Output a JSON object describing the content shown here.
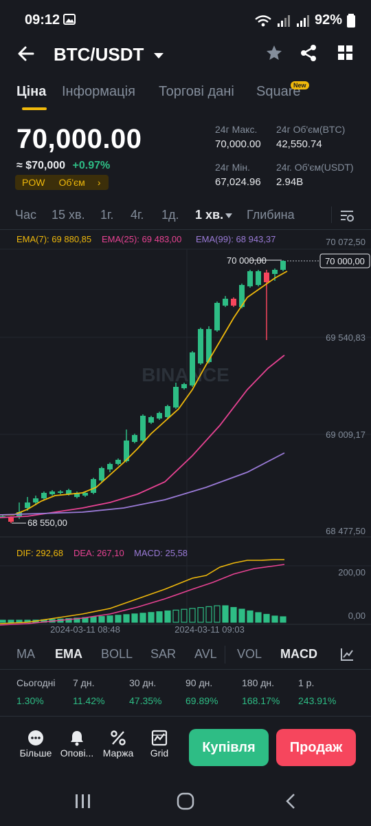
{
  "status_bar": {
    "time": "09:12",
    "battery": "92%"
  },
  "header": {
    "pair": "BTC/USDT"
  },
  "tabs": [
    {
      "label": "Ціна"
    },
    {
      "label": "Інформація"
    },
    {
      "label": "Торгові дані"
    },
    {
      "label": "Square",
      "badge": "New"
    }
  ],
  "price": {
    "last": "70,000.00",
    "usd": "≈ $70,000",
    "change": "+0.97%",
    "tag_pow": "POW",
    "tag_volume": "Об'єм",
    "tag_arrow": "›"
  },
  "stats": {
    "high_label": "24г Макс.",
    "high_value": "70,000.00",
    "vol_btc_label": "24г Об'єм(BTC)",
    "vol_btc_value": "42,550.74",
    "low_label": "24г Мін.",
    "low_value": "67,024.96",
    "vol_usdt_label": "24г. Об'єм(USDT)",
    "vol_usdt_value": "2.94B"
  },
  "timeframes": [
    {
      "label": "Час"
    },
    {
      "label": "15 хв."
    },
    {
      "label": "1г."
    },
    {
      "label": "4г."
    },
    {
      "label": "1д."
    },
    {
      "label": "1 хв."
    },
    {
      "label": "Глибина"
    }
  ],
  "ema_legend": {
    "ema7": "EMA(7): 69 880,85",
    "ema25": "EMA(25): 69 483,00",
    "ema99": "EMA(99): 68 943,37"
  },
  "price_axis": [
    "70 072,50",
    "69 540,83",
    "69 009,17",
    "68 477,50"
  ],
  "price_marker": "70 000,00",
  "high_annotation": "70 000,00",
  "low_annotation": "68 550,00",
  "watermark": "BINANCE",
  "macd_legend": {
    "dif": "DIF: 292,68",
    "dea": "DEA: 267,10",
    "macd": "MACD: 25,58"
  },
  "macd_axis": [
    "200,00",
    "0,00"
  ],
  "time_axis": [
    "2024-03-11 08:48",
    "2024-03-11 09:03"
  ],
  "indicators": [
    {
      "label": "MA"
    },
    {
      "label": "EMA"
    },
    {
      "label": "BOLL"
    },
    {
      "label": "SAR"
    },
    {
      "label": "AVL"
    },
    {
      "label": "VOL"
    },
    {
      "label": "MACD"
    }
  ],
  "performance": [
    {
      "label": "Сьогодні",
      "value": "1.30%"
    },
    {
      "label": "7 дн.",
      "value": "11.42%"
    },
    {
      "label": "30 дн.",
      "value": "47.35%"
    },
    {
      "label": "90 дн.",
      "value": "69.89%"
    },
    {
      "label": "180 дн.",
      "value": "168.17%"
    },
    {
      "label": "1 р.",
      "value": "243.91%"
    }
  ],
  "bottom_actions": [
    {
      "label": "Більше",
      "icon": "more-icon"
    },
    {
      "label": "Опові...",
      "icon": "bell-icon"
    },
    {
      "label": "Маржа",
      "icon": "percent-icon"
    },
    {
      "label": "Grid",
      "icon": "grid-bot-icon"
    }
  ],
  "buy_label": "Купівля",
  "sell_label": "Продаж",
  "colors": {
    "up": "#2ebd85",
    "down": "#f6465d",
    "ema7": "#f0b90b",
    "ema25": "#e84393",
    "ema99": "#9b7bd8",
    "accent": "#f0b90b"
  }
}
